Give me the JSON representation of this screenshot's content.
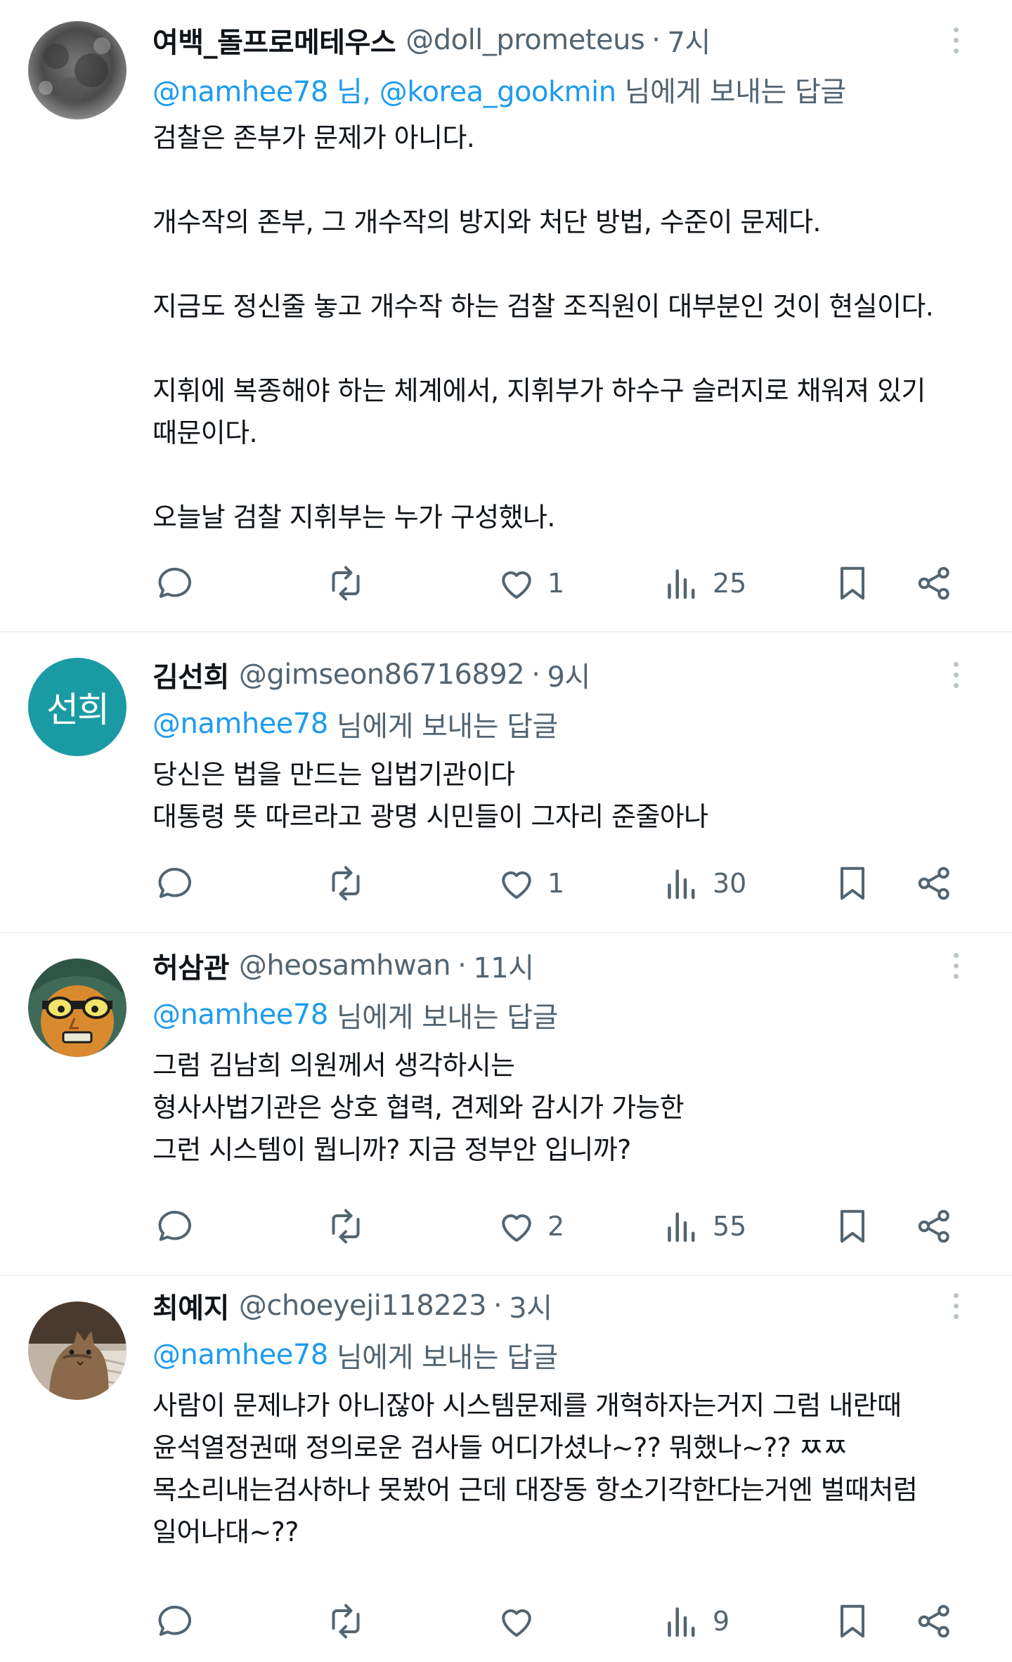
{
  "tweets": [
    {
      "name": "여백_돌프로메테우스",
      "handle": "@doll_prometeus",
      "time": "7시",
      "reply_prefix": "@namhee78 님, @korea_gookmin",
      "reply_suffix": " 님에게 보내는 답글",
      "lines": [
        "검찰은 존부가 문제가 아니다.",
        "",
        "개수작의 존부, 그 개수작의 방지와 처단 방법, 수준이 문제다.",
        "",
        "지금도 정신줄 놓고 개수작 하는 검찰 조직원이 대부분인 것이 현실이다.",
        "",
        "지휘에 복종해야 하는 체계에서, 지휘부가 하수구 슬러지로 채워져 있기",
        "때문이다.",
        "",
        "오늘날 검찰 지휘부는 누가 구성했나."
      ],
      "likes": "1",
      "views": "25",
      "avatar_icon": "grey-texture-avatar"
    },
    {
      "name": "김선희",
      "handle": "@gimseon86716892",
      "time": "9시",
      "reply_prefix": "@namhee78",
      "reply_suffix": " 님에게 보내는 답글",
      "lines": [
        "당신은 법을 만드는 입법기관이다",
        "대통령 뜻 따르라고 광명 시민들이 그자리 준줄아나"
      ],
      "likes": "1",
      "views": "30",
      "avatar_text": "선희",
      "avatar_color": "#1a9ba4"
    },
    {
      "name": "허삼관",
      "handle": "@heosamhwan",
      "time": "11시",
      "reply_prefix": "@namhee78",
      "reply_suffix": " 님에게 보내는 답글",
      "lines": [
        "그럼 김남희 의원께서 생각하시는",
        "형사사법기관은 상호 협력, 견제와 감시가 가능한",
        "그런 시스템이 뭡니까? 지금 정부안 입니까?"
      ],
      "likes": "2",
      "views": "55",
      "avatar_icon": "cartoon-face-avatar"
    },
    {
      "name": "최예지",
      "handle": "@choeyeji118223",
      "time": "3시",
      "reply_prefix": "@namhee78",
      "reply_suffix": " 님에게 보내는 답글",
      "lines": [
        "사람이 문제냐가 아니잖아 시스템문제를 개혁하자는거지 그럼 내란때",
        "윤석열정권때 정의로운 검사들 어디가셨나~?? 뭐했나~?? ㅉㅉ",
        "목소리내는검사하나 못봤어 근데 대장동 항소기각한다는거엔 벌때처럼",
        "일어나대~??"
      ],
      "likes": "",
      "views": "9",
      "avatar_icon": "cat-photo-avatar"
    }
  ],
  "colors": {
    "text": "#0f1419",
    "secondary": "#536471",
    "mention": "#1d9bf0",
    "divider": "#eff3f4"
  }
}
